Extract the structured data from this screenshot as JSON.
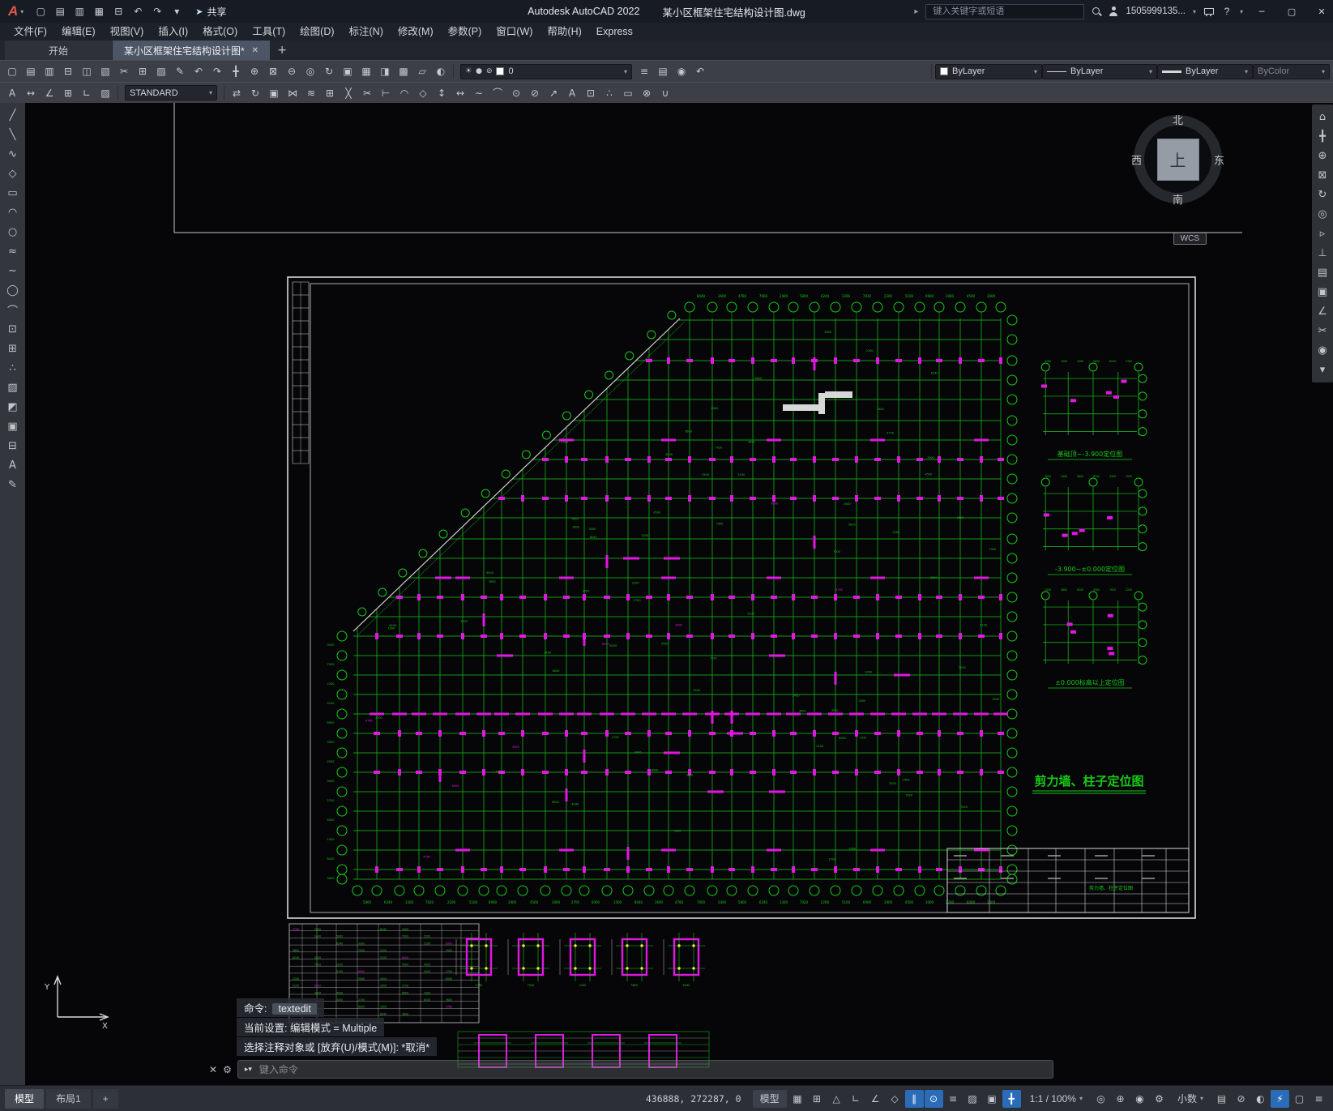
{
  "titlebar": {
    "app_button_label": "A",
    "quick_access": [
      {
        "name": "new-file-button",
        "glyph": "▢"
      },
      {
        "name": "open-file-button",
        "glyph": "▤"
      },
      {
        "name": "save-button",
        "glyph": "▥"
      },
      {
        "name": "save-as-button",
        "glyph": "▦"
      },
      {
        "name": "plot-button",
        "glyph": "⊟"
      },
      {
        "name": "undo-button",
        "glyph": "↶"
      },
      {
        "name": "redo-button",
        "glyph": "↷"
      },
      {
        "name": "customize-quick-access-button",
        "glyph": "▾"
      }
    ],
    "share_label": "共享",
    "app_title": "Autodesk AutoCAD 2022",
    "doc_title": "某小区框架住宅结构设计图.dwg",
    "search_placeholder": "键入关键字或短语",
    "user_label": "1505999135...",
    "window": {
      "minimize": "─",
      "maximize": "▢",
      "close": "✕"
    }
  },
  "menubar": {
    "items": [
      {
        "name": "menu-file",
        "label": "文件(F)"
      },
      {
        "name": "menu-edit",
        "label": "编辑(E)"
      },
      {
        "name": "menu-view",
        "label": "视图(V)"
      },
      {
        "name": "menu-insert",
        "label": "插入(I)"
      },
      {
        "name": "menu-format",
        "label": "格式(O)"
      },
      {
        "name": "menu-tools",
        "label": "工具(T)"
      },
      {
        "name": "menu-draw",
        "label": "绘图(D)"
      },
      {
        "name": "menu-dimension",
        "label": "标注(N)"
      },
      {
        "name": "menu-modify",
        "label": "修改(M)"
      },
      {
        "name": "menu-parametric",
        "label": "参数(P)"
      },
      {
        "name": "menu-window",
        "label": "窗口(W)"
      },
      {
        "name": "menu-help",
        "label": "帮助(H)"
      },
      {
        "name": "menu-express",
        "label": "Express"
      }
    ]
  },
  "filetabs": {
    "start_tab": "开始",
    "doc_tab": "某小区框架住宅结构设计图*",
    "close_glyph": "✕",
    "new_tab_glyph": "+"
  },
  "toolbar1": {
    "icons_a": [
      {
        "name": "new-button",
        "glyph": "▢"
      },
      {
        "name": "open-button",
        "glyph": "▤"
      },
      {
        "name": "save-doc-button",
        "glyph": "▥"
      },
      {
        "name": "plot-doc-button",
        "glyph": "⊟"
      },
      {
        "name": "plot-preview-button",
        "glyph": "◫"
      },
      {
        "name": "publish-button",
        "glyph": "▧"
      },
      {
        "name": "cut-button",
        "glyph": "✂"
      },
      {
        "name": "copy-button",
        "glyph": "⊞"
      },
      {
        "name": "paste-button",
        "glyph": "▨"
      },
      {
        "name": "match-properties-button",
        "glyph": "✎"
      },
      {
        "name": "undo-toolbar-button",
        "glyph": "↶"
      },
      {
        "name": "redo-toolbar-button",
        "glyph": "↷"
      },
      {
        "name": "pan-button",
        "glyph": "╋"
      },
      {
        "name": "zoom-realtime-button",
        "glyph": "⊕"
      },
      {
        "name": "zoom-window-button",
        "glyph": "⊠"
      },
      {
        "name": "zoom-previous-button",
        "glyph": "⊖"
      },
      {
        "name": "zoom-extents-button",
        "glyph": "◎"
      },
      {
        "name": "orbit-button",
        "glyph": "↻"
      },
      {
        "name": "properties-palette-button",
        "glyph": "▣"
      },
      {
        "name": "designcenter-button",
        "glyph": "▦"
      },
      {
        "name": "tool-palettes-button",
        "glyph": "◨"
      },
      {
        "name": "sheet-set-manager-button",
        "glyph": "▩"
      },
      {
        "name": "markup-button",
        "glyph": "▱"
      },
      {
        "name": "render-button",
        "glyph": "◐"
      }
    ],
    "layer_value": "0",
    "icons_b": [
      {
        "name": "layer-properties-button",
        "glyph": "≡"
      },
      {
        "name": "layer-states-button",
        "glyph": "▤"
      },
      {
        "name": "make-object-layer-current-button",
        "glyph": "◉"
      },
      {
        "name": "layer-previous-button",
        "glyph": "↶"
      }
    ],
    "color_value": "ByLayer",
    "linetype_value": "ByLayer",
    "lineweight_value": "ByLayer",
    "plotstyle_value": "ByColor"
  },
  "toolbar2": {
    "icons_a": [
      {
        "name": "text-style-button",
        "glyph": "A"
      },
      {
        "name": "dim-linear-button",
        "glyph": "↔"
      },
      {
        "name": "dim-angular-button",
        "glyph": "∠"
      },
      {
        "name": "table-style-button",
        "glyph": "⊞"
      },
      {
        "name": "multileader-button",
        "glyph": "∟"
      },
      {
        "name": "hatch-button",
        "glyph": "▨"
      }
    ],
    "style_value": "STANDARD",
    "icons_b": [
      {
        "name": "move-button",
        "glyph": "⇄"
      },
      {
        "name": "rotate-button",
        "glyph": "↻"
      },
      {
        "name": "copy-object-button",
        "glyph": "▣"
      },
      {
        "name": "mirror-button",
        "glyph": "⋈"
      },
      {
        "name": "offset-button",
        "glyph": "≋"
      },
      {
        "name": "array-button",
        "glyph": "⊞"
      },
      {
        "name": "erase-button",
        "glyph": "╳"
      },
      {
        "name": "trim-button",
        "glyph": "✂"
      },
      {
        "name": "extend-button",
        "glyph": "⊢"
      },
      {
        "name": "fillet-button",
        "glyph": "◠"
      },
      {
        "name": "chamfer-button",
        "glyph": "◇"
      },
      {
        "name": "scale-button",
        "glyph": "↕"
      },
      {
        "name": "stretch-button",
        "glyph": "↔"
      },
      {
        "name": "lengthen-button",
        "glyph": "∼"
      },
      {
        "name": "dim-aligned-button",
        "glyph": "⌒"
      },
      {
        "name": "dim-radius-button",
        "glyph": "⊙"
      },
      {
        "name": "dim-diameter-button",
        "glyph": "⊘"
      },
      {
        "name": "leader-button",
        "glyph": "↗"
      },
      {
        "name": "single-text-button",
        "glyph": "A"
      },
      {
        "name": "insert-block-button",
        "glyph": "⊡"
      },
      {
        "name": "point-style-button",
        "glyph": "∴"
      },
      {
        "name": "region-button",
        "glyph": "▭"
      },
      {
        "name": "explode-button",
        "glyph": "⊗"
      },
      {
        "name": "join-button",
        "glyph": "∪"
      }
    ]
  },
  "left_toolbar": {
    "icons": [
      {
        "name": "line-tool",
        "glyph": "╱"
      },
      {
        "name": "xline-tool",
        "glyph": "╲"
      },
      {
        "name": "polyline-tool",
        "glyph": "∿"
      },
      {
        "name": "polygon-tool",
        "glyph": "◇"
      },
      {
        "name": "rectangle-tool",
        "glyph": "▭"
      },
      {
        "name": "arc-tool",
        "glyph": "◠"
      },
      {
        "name": "circle-tool",
        "glyph": "○"
      },
      {
        "name": "revcloud-tool",
        "glyph": "≈"
      },
      {
        "name": "spline-tool",
        "glyph": "∼"
      },
      {
        "name": "ellipse-tool",
        "glyph": "◯"
      },
      {
        "name": "ellipse-arc-tool",
        "glyph": "⌒"
      },
      {
        "name": "insert-block-tool",
        "glyph": "⊡"
      },
      {
        "name": "create-block-tool",
        "glyph": "⊞"
      },
      {
        "name": "point-tool",
        "glyph": "∴"
      },
      {
        "name": "hatch-tool",
        "glyph": "▨"
      },
      {
        "name": "gradient-tool",
        "glyph": "◩"
      },
      {
        "name": "region-tool",
        "glyph": "▣"
      },
      {
        "name": "table-tool",
        "glyph": "⊟"
      },
      {
        "name": "mtext-tool",
        "glyph": "A"
      },
      {
        "name": "addselected-tool",
        "glyph": "✎"
      }
    ]
  },
  "right_toolbar": {
    "icons": [
      {
        "name": "viewcube-home-button",
        "glyph": "⌂"
      },
      {
        "name": "pan-tool-button",
        "glyph": "╋"
      },
      {
        "name": "zoom-extents-nav-button",
        "glyph": "⊕"
      },
      {
        "name": "zoom-window-nav-button",
        "glyph": "⊠"
      },
      {
        "name": "orbit-nav-button",
        "glyph": "↻"
      },
      {
        "name": "steering-wheel-button",
        "glyph": "◎"
      },
      {
        "name": "show-motion-button",
        "glyph": "▹"
      },
      {
        "name": "ucs-toggle-button",
        "glyph": "⊥"
      },
      {
        "name": "named-views-button",
        "glyph": "▤"
      },
      {
        "name": "viewport-button",
        "glyph": "▣"
      },
      {
        "name": "measure-button",
        "glyph": "∠"
      },
      {
        "name": "section-button",
        "glyph": "✂"
      },
      {
        "name": "camera-button",
        "glyph": "◉"
      },
      {
        "name": "navigation-more-button",
        "glyph": "▾"
      }
    ]
  },
  "navcube": {
    "north": "北",
    "south": "南",
    "west": "西",
    "east": "东",
    "top": "上"
  },
  "drawing": {
    "colors": {
      "grid": "#17c917",
      "column": "#e316e3",
      "line_white": "#d8d8d8",
      "yellow": "#f5e642"
    },
    "title": "剪力墙、柱子定位图",
    "detail_captions": [
      "基础顶~-3.900定位图",
      "-3.900~±0.000定位图",
      "±0.000标高以上定位图"
    ],
    "wcs_label": "WCS",
    "ucs": {
      "x_label": "X",
      "y_label": "Y"
    },
    "dims": [
      "4780",
      "7000",
      "2400",
      "5800",
      "6240",
      "3300",
      "7020",
      "2200",
      "5100",
      "6900",
      "3900",
      "4500",
      "3000",
      "2700",
      "6000",
      "1500",
      "8040",
      "3600"
    ]
  },
  "command": {
    "line1_label": "命令:",
    "line1_value": "textedit",
    "line2": "当前设置: 编辑模式 = Multiple",
    "line3": "选择注释对象或 [放弃(U)/模式(M)]: *取消*",
    "placeholder": "键入命令"
  },
  "statusbar": {
    "layout_tabs": [
      {
        "name": "model-layout-tab",
        "label": "模型",
        "active": true
      },
      {
        "name": "layout1-tab",
        "label": "布局1",
        "active": false
      },
      {
        "name": "new-layout-button",
        "label": "+",
        "active": false
      }
    ],
    "coords": "436888, 272287, 0",
    "model_button": "模型",
    "toggles_a": [
      {
        "name": "grid-toggle",
        "glyph": "▦",
        "active": false
      },
      {
        "name": "snap-toggle",
        "glyph": "⊞",
        "active": false
      },
      {
        "name": "infer-constraints-toggle",
        "glyph": "△",
        "active": false
      },
      {
        "name": "ortho-toggle",
        "glyph": "∟",
        "active": false
      },
      {
        "name": "polar-tracking-toggle",
        "glyph": "∠",
        "active": false
      },
      {
        "name": "isodraft-toggle",
        "glyph": "◇",
        "active": false
      },
      {
        "name": "otrack-toggle",
        "glyph": "∥",
        "active": true
      },
      {
        "name": "osnap-toggle",
        "glyph": "⊙",
        "active": true
      },
      {
        "name": "lineweight-display-toggle",
        "glyph": "≡",
        "active": false
      },
      {
        "name": "transparency-toggle",
        "glyph": "▨",
        "active": false
      },
      {
        "name": "selection-cycling-toggle",
        "glyph": "▣",
        "active": false
      },
      {
        "name": "dynamic-input-toggle",
        "glyph": "╋",
        "active": true
      }
    ],
    "scale_label": "1:1 / 100%",
    "toggles_b": [
      {
        "name": "annotation-visibility-toggle",
        "glyph": "◎",
        "active": false
      },
      {
        "name": "autoscale-toggle",
        "glyph": "⊕",
        "active": false
      },
      {
        "name": "annotation-monitor-toggle",
        "glyph": "◉",
        "active": false
      },
      {
        "name": "workspace-switching-button",
        "glyph": "⚙",
        "active": false
      }
    ],
    "units_label": "小数",
    "toggles_c": [
      {
        "name": "quick-properties-toggle",
        "glyph": "▤",
        "active": false
      },
      {
        "name": "lock-ui-button",
        "glyph": "⊘",
        "active": false
      },
      {
        "name": "isolate-objects-button",
        "glyph": "◐",
        "active": false
      },
      {
        "name": "graphics-performance-toggle",
        "glyph": "⚡",
        "active": true
      },
      {
        "name": "clean-screen-button",
        "glyph": "▢",
        "active": false
      },
      {
        "name": "customization-button",
        "glyph": "≡",
        "active": false
      }
    ]
  }
}
